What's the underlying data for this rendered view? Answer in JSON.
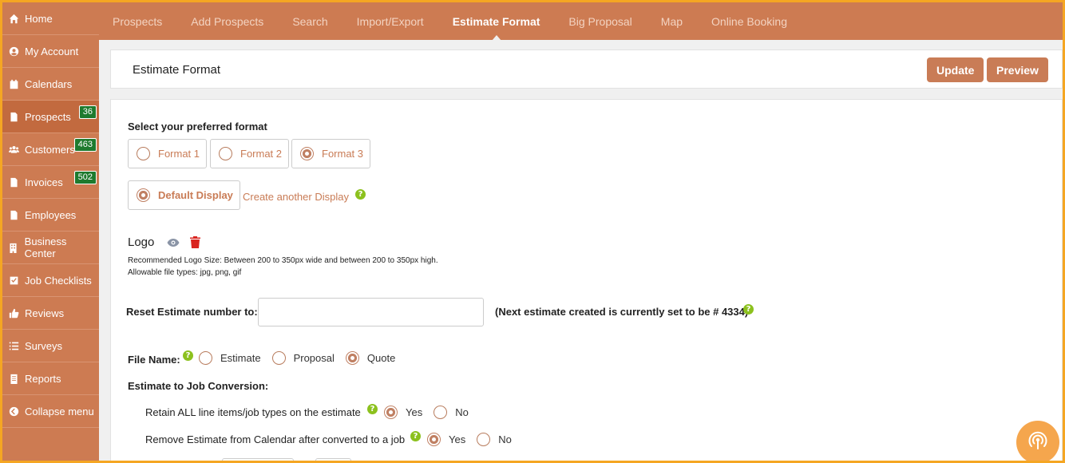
{
  "sidebar": {
    "items": [
      {
        "label": "Home",
        "icon": "home-icon"
      },
      {
        "label": "My Account",
        "icon": "user-circle-icon"
      },
      {
        "label": "Calendars",
        "icon": "calendar-icon"
      },
      {
        "label": "Prospects",
        "icon": "document-icon",
        "badge": "36"
      },
      {
        "label": "Customers",
        "icon": "users-icon",
        "badge": "463"
      },
      {
        "label": "Invoices",
        "icon": "document-icon",
        "badge": "502"
      },
      {
        "label": "Employees",
        "icon": "document-icon"
      },
      {
        "label": "Business Center",
        "icon": "building-icon"
      },
      {
        "label": "Job Checklists",
        "icon": "checkbox-icon"
      },
      {
        "label": "Reviews",
        "icon": "thumbs-up-icon"
      },
      {
        "label": "Surveys",
        "icon": "list-icon"
      },
      {
        "label": "Reports",
        "icon": "report-icon"
      },
      {
        "label": "Collapse menu",
        "icon": "chevron-left-circle-icon"
      }
    ]
  },
  "topnav": {
    "items": [
      "Prospects",
      "Add Prospects",
      "Search",
      "Import/Export",
      "Estimate Format",
      "Big Proposal",
      "Map",
      "Online Booking"
    ],
    "active": "Estimate Format"
  },
  "header": {
    "title": "Estimate Format",
    "update_label": "Update",
    "preview_label": "Preview"
  },
  "format": {
    "heading": "Select your preferred format",
    "options": [
      "Format 1",
      "Format 2",
      "Format 3"
    ],
    "selected": "Format 3"
  },
  "display": {
    "default_label": "Default Display",
    "create_link": "Create another Display"
  },
  "logo": {
    "label": "Logo",
    "size_note": "Recommended Logo Size: Between 200 to 350px wide and between 200 to 350px high.",
    "types_note": "Allowable file types: jpg, png, gif"
  },
  "reset": {
    "label": "Reset Estimate number to:",
    "value": "",
    "note": "(Next estimate created is currently set to be # 4334)"
  },
  "file_name": {
    "label": "File Name:",
    "options": [
      "Estimate",
      "Proposal",
      "Quote"
    ],
    "selected": "Quote"
  },
  "conversion": {
    "heading": "Estimate to Job Conversion:",
    "retain_label": "Retain ALL line items/job types on the estimate",
    "retain_options": [
      "Yes",
      "No"
    ],
    "retain_selected": "Yes",
    "remove_label": "Remove Estimate from Calendar after converted to a job",
    "remove_options": [
      "Yes",
      "No"
    ],
    "remove_selected": "Yes"
  },
  "help_glyph": "?",
  "colors": {
    "brand": "#cd7b52",
    "accent_button": "#c97c56",
    "badge": "#1e7a2e",
    "help": "#8cc11e",
    "fab": "#f5a64d"
  }
}
